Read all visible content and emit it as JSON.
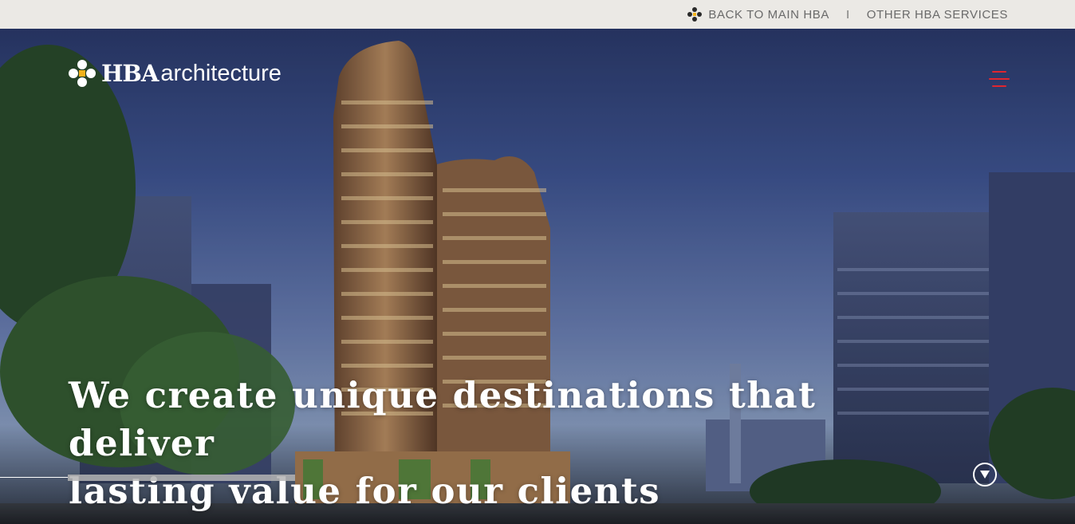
{
  "topbar": {
    "back_label": "BACK TO MAIN HBA",
    "separator": "I",
    "other_label": "OTHER HBA SERVICES"
  },
  "logo": {
    "brand": "HBA",
    "suffix": "architecture"
  },
  "hero": {
    "headline_line1": "We create unique destinations that deliver",
    "headline_line2": "lasting value for our clients"
  },
  "colors": {
    "topbar_bg": "#ebe9e5",
    "menu_accent": "#e0262f",
    "logo_accent": "#f2b21b"
  },
  "icons": {
    "menu": "hamburger-menu-icon",
    "scroll": "arrow-down-circle-icon",
    "logo": "hba-flower-mark-icon"
  }
}
